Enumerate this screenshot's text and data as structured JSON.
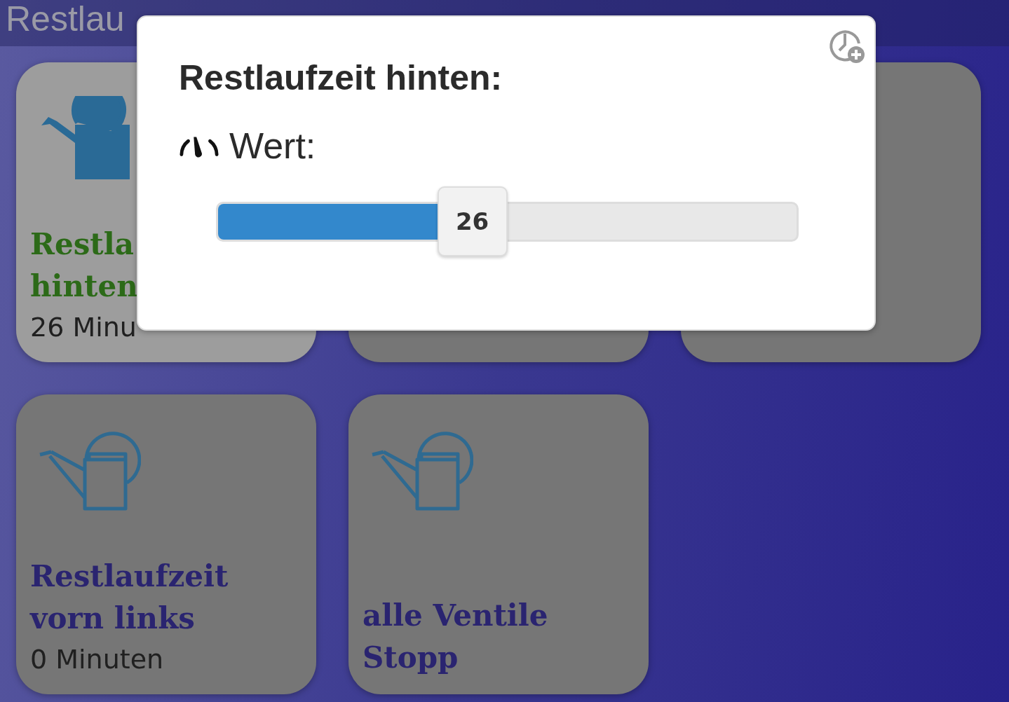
{
  "header": {
    "title": "Restlau"
  },
  "cards": [
    {
      "title_lines": [
        "Restla",
        "hinten"
      ],
      "value": "26 Minu",
      "active": true
    },
    {
      "active": false
    },
    {
      "active": false
    },
    {
      "title_lines": [
        "Restlaufzeit",
        "vorn links"
      ],
      "value": "0 Minuten",
      "active": false
    },
    {
      "title_lines": [
        "alle Ventile",
        "Stopp"
      ],
      "active": false
    }
  ],
  "dialog": {
    "title": "Restlaufzeit hinten:",
    "label": "Wert:",
    "slider": {
      "value": "26",
      "level": 0.44
    }
  }
}
